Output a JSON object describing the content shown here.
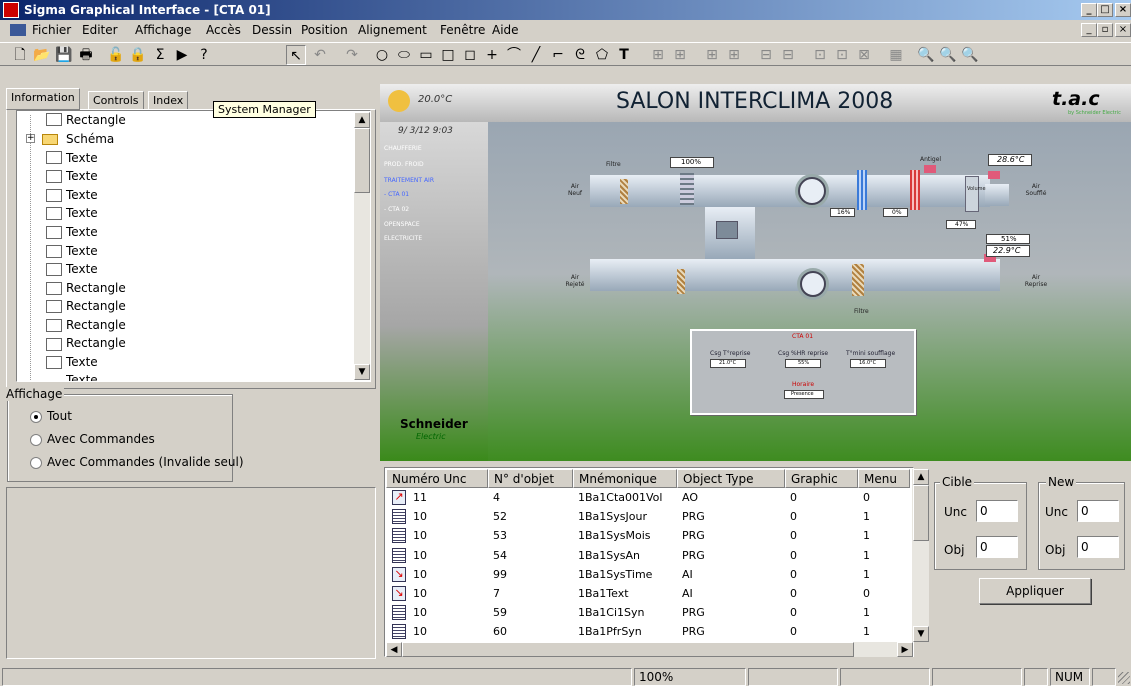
{
  "window": {
    "title": "Sigma Graphical Interface - [CTA 01]"
  },
  "menu": [
    "Fichier",
    "Editer",
    "Affichage",
    "Accès",
    "Dessin",
    "Position",
    "Alignement",
    "Fenêtre",
    "Aide"
  ],
  "tabs": [
    "Information",
    "Controls",
    "Index"
  ],
  "tooltip": "System Manager",
  "tree": [
    "Rectangle",
    "Schéma",
    "Texte",
    "Texte",
    "Texte",
    "Texte",
    "Texte",
    "Texte",
    "Texte",
    "Rectangle",
    "Rectangle",
    "Rectangle",
    "Rectangle",
    "Texte",
    "Texte"
  ],
  "affichage": {
    "label": "Affichage",
    "options": [
      "Tout",
      "Avec Commandes",
      "Avec Commandes (Invalide seul)"
    ]
  },
  "scada": {
    "temp": "20.0°C",
    "title": "SALON INTERCLIMA 2008",
    "brand": "t.a.c",
    "brand_sub": "by Schneider Electric",
    "datetime": "9/ 3/12   9:03",
    "nav": [
      "CHAUFFERIE",
      "PROD. FROID",
      "TRAITEMENT AIR",
      "- CTA 01",
      "- CTA 02",
      "OPENSPACE",
      "ELECTRICITE"
    ],
    "schneider": "Schneider",
    "electric": "Electric",
    "labels": {
      "filtre1": "Filtre",
      "filtre2": "Filtre",
      "pct100": "100%",
      "antigel": "Antigel",
      "t1": "28.6°C",
      "airneuf": "Air Neuf",
      "airsouffle": "Air Soufflé",
      "p16": "16%",
      "p0": "0%",
      "p47": "47%",
      "p51": "51%",
      "t2": "22.9°C",
      "airrejet": "Air Rejeté",
      "airreprise": "Air Reprise",
      "volume": "Volume"
    },
    "panel": {
      "title": "CTA 01",
      "c1": "Csg T°reprise",
      "v1": "21.0°C",
      "c2": "Csg %HR reprise",
      "v2": "55%",
      "c3": "T°mini soufflage",
      "v3": "16.0°C",
      "c4": "Horaire",
      "v4": "Presence"
    }
  },
  "table": {
    "headers": [
      "Numéro Unc",
      "N° d'objet",
      "Mnémonique",
      "Object Type",
      "Graphic",
      "Menu"
    ],
    "rows": [
      [
        "11",
        "4",
        "1Ba1Cta001Vol",
        "AO",
        "0",
        "0"
      ],
      [
        "10",
        "52",
        "1Ba1SysJour",
        "PRG",
        "0",
        "1"
      ],
      [
        "10",
        "53",
        "1Ba1SysMois",
        "PRG",
        "0",
        "1"
      ],
      [
        "10",
        "54",
        "1Ba1SysAn",
        "PRG",
        "0",
        "1"
      ],
      [
        "10",
        "99",
        "1Ba1SysTime",
        "AI",
        "0",
        "1"
      ],
      [
        "10",
        "7",
        "1Ba1Text",
        "AI",
        "0",
        "0"
      ],
      [
        "10",
        "59",
        "1Ba1Ci1Syn",
        "PRG",
        "0",
        "1"
      ],
      [
        "10",
        "60",
        "1Ba1PfrSyn",
        "PRG",
        "0",
        "1"
      ]
    ],
    "icons": [
      "analog-output-icon",
      "program-icon",
      "program-icon",
      "program-icon",
      "analog-input-icon",
      "analog-input-icon",
      "program-icon",
      "program-icon"
    ]
  },
  "cible": {
    "label": "Cible",
    "unc_label": "Unc",
    "unc": "0",
    "obj_label": "Obj",
    "obj": "0"
  },
  "new": {
    "label": "New",
    "unc_label": "Unc",
    "unc": "0",
    "obj_label": "Obj",
    "obj": "0"
  },
  "apply": "Appliquer",
  "status": {
    "zoom": "100%",
    "num": "NUM"
  }
}
